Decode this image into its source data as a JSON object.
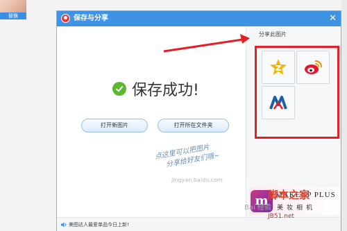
{
  "background": {
    "thumbnail_label": "替换"
  },
  "dialog": {
    "title": "保存与分享",
    "close": "✕",
    "success_text": "保存成功!",
    "buttons": {
      "open_image": "打开新图片",
      "open_folder": "打开所在文件夹"
    },
    "hint": {
      "line1": "点这里可以把图片",
      "line2": "分享给好友们哦~"
    },
    "share": {
      "title": "分享此图片",
      "items": [
        {
          "name": "qzone",
          "icon": "qzone-star-icon",
          "color": "#f5b400"
        },
        {
          "name": "weibo",
          "icon": "weibo-icon",
          "color": "#e6162d"
        },
        {
          "name": "renren",
          "icon": "renren-icon",
          "color": "#1c5ea8"
        }
      ]
    },
    "ad": {
      "logo": "m",
      "brand": "MAKEUP PLUS",
      "subtitle": "美妆相机"
    },
    "status": {
      "icon": "speaker-icon",
      "text": "美图达人最爱单品今日上新!"
    }
  },
  "watermarks": {
    "jingyan": "jingyan.baidu.com",
    "baidu": "Bai 经验",
    "site": "脚本之家",
    "site_url": "JB51.net"
  },
  "colors": {
    "titlebar": "#3f93e5",
    "highlight": "#e41f26",
    "success": "#5cb82e"
  }
}
